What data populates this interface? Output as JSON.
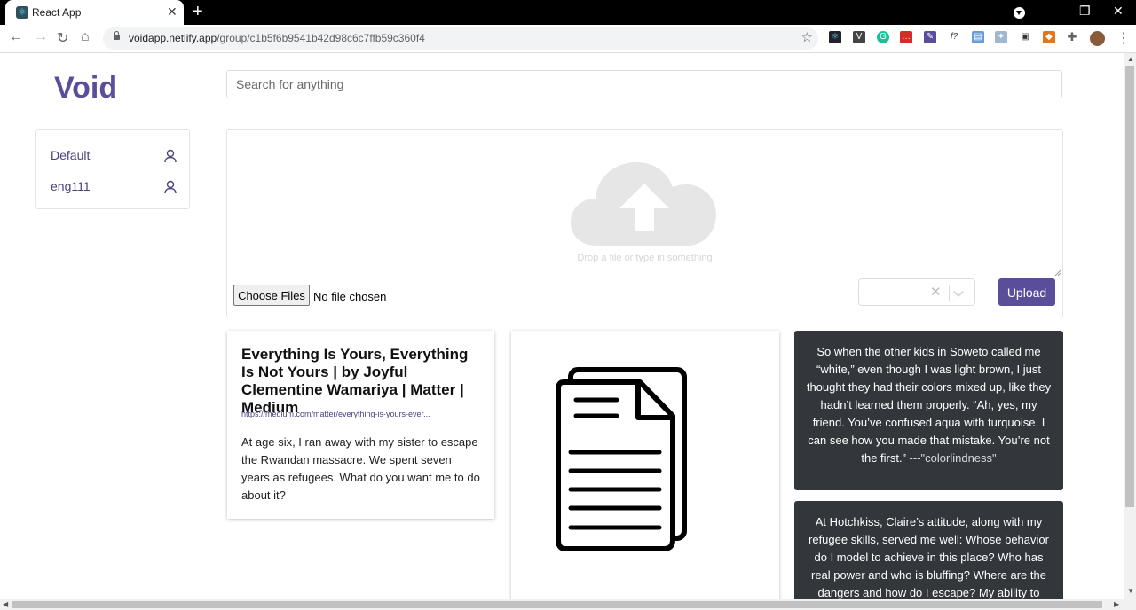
{
  "browser": {
    "tab_title": "React App",
    "url_host": "voidapp.netlify.app",
    "url_path": "/group/c1b5f6b9541b42d98c6c7ffb59c360f4",
    "extensions": [
      "react-devtools",
      "vue-devtools",
      "grammarly",
      "lastpass",
      "eyedropper",
      "fx",
      "reader",
      "translate",
      "pip",
      "metamask",
      "puzzle"
    ]
  },
  "app": {
    "logo": "Void",
    "search_placeholder": "Search for anything"
  },
  "sidebar": {
    "items": [
      {
        "label": "Default",
        "icon": "user-icon"
      },
      {
        "label": "eng111",
        "icon": "user-icon"
      }
    ]
  },
  "upload": {
    "drop_text": "Drop a file or type in something",
    "choose_label": "Choose Files",
    "no_file": "No file chosen",
    "select_value": "",
    "button_label": "Upload"
  },
  "cards": [
    {
      "type": "link",
      "title": "Everything Is Yours, Everything Is Not Yours | by Joyful Clementine Wamariya | Matter | Medium",
      "url": "https://medium.com/matter/everything-is-yours-ever...",
      "description": "At age six, I ran away with my sister to escape the Rwandan massacre. We spent seven years as refugees. What do you want me to do about it?"
    },
    {
      "type": "document",
      "icon": "document-icon"
    },
    {
      "type": "quote",
      "text": "So when the other kids in Soweto called me “white,” even though I was light brown, I just thought they had their colors mixed up, like they hadn’t learned them properly. “Ah, yes, my friend. You’ve confused aqua with turquoise. I can see how you made that mistake. You’re not the first.”",
      "source": " ---\"colorlindness\""
    },
    {
      "type": "quote",
      "text": "At Hotchkiss, Claire’s attitude, along with my refugee skills, served me well: Whose behavior do I model to achieve in this place? Who has real power and who is bluffing? Where are the dangers and how do I escape? My ability to"
    }
  ],
  "colors": {
    "brand": "#5a4e9b",
    "quote_bg": "#33363b"
  }
}
